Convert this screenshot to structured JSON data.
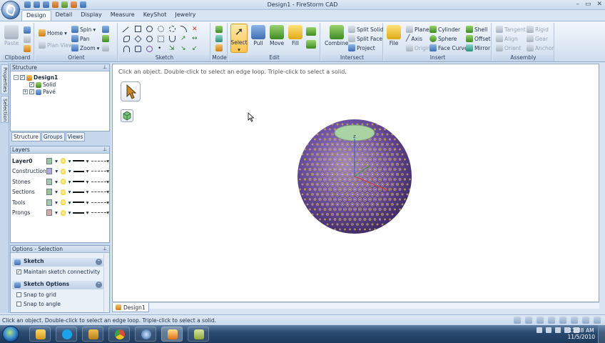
{
  "window": {
    "title": "Design1 - FireStorm CAD",
    "controls": [
      "–",
      "▭",
      "✕"
    ]
  },
  "menu_tabs": [
    "Design",
    "Detail",
    "Display",
    "Measure",
    "KeyShot",
    "Jewelry"
  ],
  "ribbon": {
    "clipboard": {
      "label": "Clipboard",
      "paste": "Paste"
    },
    "orient": {
      "label": "Orient",
      "home": "Home",
      "spin": "Spin",
      "pan": "Pan",
      "zoom": "Zoom",
      "plan_view": "Plan View"
    },
    "sketch": {
      "label": "Sketch"
    },
    "mode": {
      "label": "Mode"
    },
    "edit": {
      "label": "Edit",
      "select": "Select",
      "pull": "Pull",
      "move": "Move",
      "fill": "Fill"
    },
    "intersect": {
      "label": "Intersect",
      "combine": "Combine",
      "split_solid": "Split Solid",
      "split_face": "Split Face",
      "project": "Project"
    },
    "insert": {
      "label": "Insert",
      "file": "File",
      "plane": "Plane",
      "axis": "Axis",
      "origin": "Origin",
      "cylinder": "Cylinder",
      "sphere": "Sphere",
      "face_curve": "Face Curve",
      "shell": "Shell",
      "offset": "Offset",
      "mirror": "Mirror"
    },
    "assembly": {
      "label": "Assembly",
      "tangent": "Tangent",
      "align": "Align",
      "orient": "Orient",
      "rigid": "Rigid",
      "gear": "Gear",
      "anchor": "Anchor"
    }
  },
  "side_tabs": [
    "Properties",
    "Selection"
  ],
  "structure": {
    "title": "Structure",
    "root": "Design1",
    "children": [
      "Solid",
      "Pavé"
    ],
    "tabs": [
      "Structure",
      "Groups",
      "Views"
    ]
  },
  "layers": {
    "title": "Layers",
    "rows": [
      {
        "name": "Layer0",
        "color": "#9bc79b"
      },
      {
        "name": "Construction",
        "color": "#b8a6d6"
      },
      {
        "name": "Stones",
        "color": "#a8c8a8"
      },
      {
        "name": "Sections",
        "color": "#9fbf8f"
      },
      {
        "name": "Tools",
        "color": "#a9c7a9"
      },
      {
        "name": "Prongs",
        "color": "#d7a9a0"
      }
    ]
  },
  "options": {
    "title": "Options - Selection",
    "sketch_header": "Sketch",
    "maintain_connectivity": "Maintain sketch connectivity",
    "sketch_options_header": "Sketch Options",
    "snap_grid": "Snap to grid",
    "snap_angle": "Snap to angle"
  },
  "canvas": {
    "hint": "Click an object. Double-click to select an edge loop. Triple-click to select a solid.",
    "axis_label": "z"
  },
  "doc_tab": "Design1",
  "status": "Click an object. Double-click to select an edge loop. Triple-click to select a solid.",
  "taskbar": {
    "time": "11:38 AM",
    "date": "11/5/2010"
  },
  "colors": {
    "accent": "#3f6fb3",
    "sphere_purple": "#6b4fa0",
    "prong_gold": "#c9a04a",
    "top_disc": "#a9d3a3"
  }
}
